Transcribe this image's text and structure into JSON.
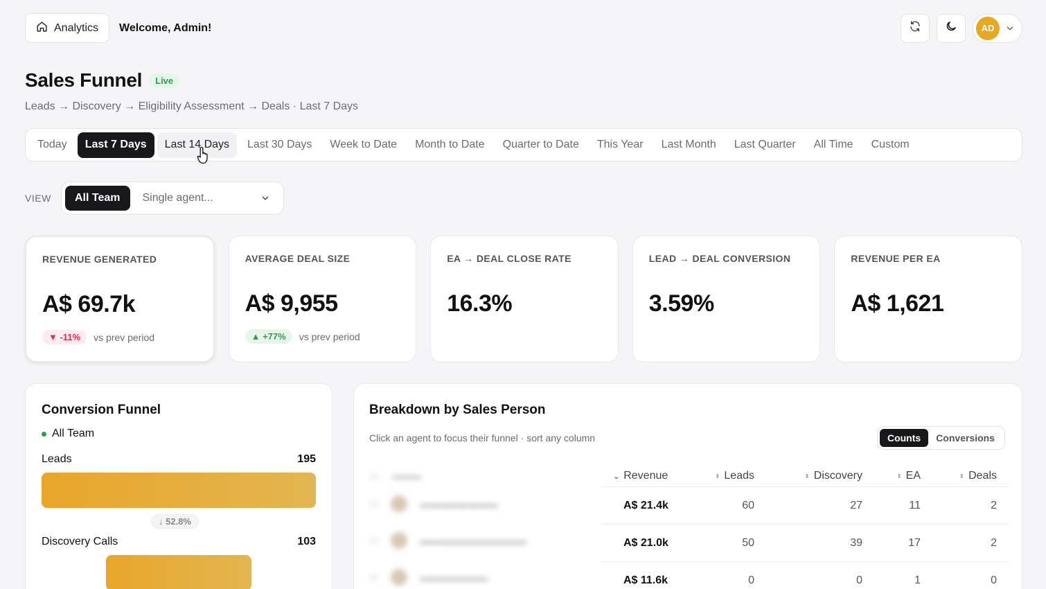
{
  "topbar": {
    "home_label": "Analytics",
    "welcome": "Welcome, Admin!",
    "avatar_initials": "AD"
  },
  "header": {
    "title": "Sales Funnel",
    "live_badge": "Live",
    "subtitle": "Leads → Discovery → Eligibility Assessment → Deals · Last 7 Days"
  },
  "ranges": [
    {
      "label": "Today"
    },
    {
      "label": "Last 7 Days",
      "active": true
    },
    {
      "label": "Last 14 Days",
      "hover": true
    },
    {
      "label": "Last 30 Days"
    },
    {
      "label": "Week to Date"
    },
    {
      "label": "Month to Date"
    },
    {
      "label": "Quarter to Date"
    },
    {
      "label": "This Year"
    },
    {
      "label": "Last Month"
    },
    {
      "label": "Last Quarter"
    },
    {
      "label": "All Time"
    },
    {
      "label": "Custom"
    }
  ],
  "view": {
    "label": "VIEW",
    "all_team": "All Team",
    "agent_placeholder": "Single agent..."
  },
  "kpis": [
    {
      "label": "REVENUE GENERATED",
      "value": "A$ 69.7k",
      "delta": "▼ -11%",
      "direction": "down",
      "delta_note": "vs prev period"
    },
    {
      "label": "AVERAGE DEAL SIZE",
      "value": "A$ 9,955",
      "delta": "▲ +77%",
      "direction": "up",
      "delta_note": "vs prev period"
    },
    {
      "label": "EA → DEAL CLOSE RATE",
      "value": "16.3%"
    },
    {
      "label": "LEAD → DEAL CONVERSION",
      "value": "3.59%"
    },
    {
      "label": "REVENUE PER EA",
      "value": "A$ 1,621"
    }
  ],
  "funnel": {
    "title": "Conversion Funnel",
    "scope": "All Team",
    "stages": [
      {
        "name": "Leads",
        "value": 195,
        "display": "195"
      },
      {
        "name": "Discovery Calls",
        "value": 103,
        "display": "103"
      }
    ],
    "drop": "↓ 52.8%"
  },
  "breakdown": {
    "title": "Breakdown by Sales Person",
    "subtitle": "Click an agent to focus their funnel · sort any column",
    "toggle": [
      "Counts",
      "Conversions"
    ],
    "columns": [
      "Revenue",
      "Leads",
      "Discovery",
      "EA",
      "Deals"
    ],
    "rows": [
      [
        "A$ 21.4k",
        "60",
        "27",
        "11",
        "2"
      ],
      [
        "A$ 21.0k",
        "50",
        "39",
        "17",
        "2"
      ],
      [
        "A$ 11.6k",
        "0",
        "0",
        "1",
        "0"
      ]
    ]
  },
  "colors": {
    "accent": "#18181b",
    "funnel_bar": "#e9a62a",
    "positive": "#2f9e4f",
    "negative": "#d9304f",
    "avatar": "#e6a91f"
  }
}
